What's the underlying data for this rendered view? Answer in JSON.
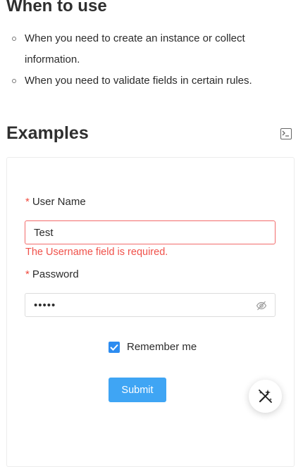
{
  "when_to_use": {
    "title": "When to use",
    "items": [
      "When you need to create an instance or collect information.",
      "When you need to validate fields in certain rules."
    ]
  },
  "examples": {
    "title": "Examples",
    "terminal_icon": "terminal-icon"
  },
  "form": {
    "username_required_mark": "*",
    "username_label": "User Name",
    "username_value": "Test",
    "username_error": "The Username field is required.",
    "password_required_mark": "*",
    "password_label": "Password",
    "password_value": "•••••",
    "password_eye_icon": "eye-off-icon",
    "remember_label": "Remember me",
    "remember_checked": true,
    "submit_label": "Submit"
  },
  "fab": {
    "icon": "magic-wand-off-icon"
  },
  "colors": {
    "primary": "#3fa5f4",
    "checkbox": "#2d8cf0",
    "error": "#f0514a"
  }
}
